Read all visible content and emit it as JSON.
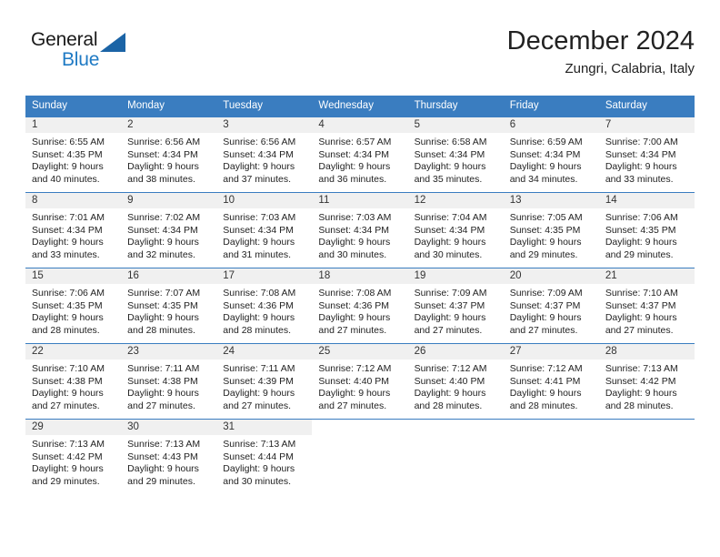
{
  "brand": {
    "name_top": "General",
    "name_bottom": "Blue",
    "accent_color": "#1f7ac4",
    "triangle_color": "#1b64a6"
  },
  "header": {
    "title": "December 2024",
    "subtitle": "Zungri, Calabria, Italy"
  },
  "theme": {
    "header_band": "#3a7dc0",
    "daynum_strip": "#f0f0f0",
    "text": "#222222"
  },
  "weekday_headers": [
    "Sunday",
    "Monday",
    "Tuesday",
    "Wednesday",
    "Thursday",
    "Friday",
    "Saturday"
  ],
  "weeks": [
    [
      {
        "day": "1",
        "sunrise": "Sunrise: 6:55 AM",
        "sunset": "Sunset: 4:35 PM",
        "daylight_line1": "Daylight: 9 hours",
        "daylight_line2": "and 40 minutes."
      },
      {
        "day": "2",
        "sunrise": "Sunrise: 6:56 AM",
        "sunset": "Sunset: 4:34 PM",
        "daylight_line1": "Daylight: 9 hours",
        "daylight_line2": "and 38 minutes."
      },
      {
        "day": "3",
        "sunrise": "Sunrise: 6:56 AM",
        "sunset": "Sunset: 4:34 PM",
        "daylight_line1": "Daylight: 9 hours",
        "daylight_line2": "and 37 minutes."
      },
      {
        "day": "4",
        "sunrise": "Sunrise: 6:57 AM",
        "sunset": "Sunset: 4:34 PM",
        "daylight_line1": "Daylight: 9 hours",
        "daylight_line2": "and 36 minutes."
      },
      {
        "day": "5",
        "sunrise": "Sunrise: 6:58 AM",
        "sunset": "Sunset: 4:34 PM",
        "daylight_line1": "Daylight: 9 hours",
        "daylight_line2": "and 35 minutes."
      },
      {
        "day": "6",
        "sunrise": "Sunrise: 6:59 AM",
        "sunset": "Sunset: 4:34 PM",
        "daylight_line1": "Daylight: 9 hours",
        "daylight_line2": "and 34 minutes."
      },
      {
        "day": "7",
        "sunrise": "Sunrise: 7:00 AM",
        "sunset": "Sunset: 4:34 PM",
        "daylight_line1": "Daylight: 9 hours",
        "daylight_line2": "and 33 minutes."
      }
    ],
    [
      {
        "day": "8",
        "sunrise": "Sunrise: 7:01 AM",
        "sunset": "Sunset: 4:34 PM",
        "daylight_line1": "Daylight: 9 hours",
        "daylight_line2": "and 33 minutes."
      },
      {
        "day": "9",
        "sunrise": "Sunrise: 7:02 AM",
        "sunset": "Sunset: 4:34 PM",
        "daylight_line1": "Daylight: 9 hours",
        "daylight_line2": "and 32 minutes."
      },
      {
        "day": "10",
        "sunrise": "Sunrise: 7:03 AM",
        "sunset": "Sunset: 4:34 PM",
        "daylight_line1": "Daylight: 9 hours",
        "daylight_line2": "and 31 minutes."
      },
      {
        "day": "11",
        "sunrise": "Sunrise: 7:03 AM",
        "sunset": "Sunset: 4:34 PM",
        "daylight_line1": "Daylight: 9 hours",
        "daylight_line2": "and 30 minutes."
      },
      {
        "day": "12",
        "sunrise": "Sunrise: 7:04 AM",
        "sunset": "Sunset: 4:34 PM",
        "daylight_line1": "Daylight: 9 hours",
        "daylight_line2": "and 30 minutes."
      },
      {
        "day": "13",
        "sunrise": "Sunrise: 7:05 AM",
        "sunset": "Sunset: 4:35 PM",
        "daylight_line1": "Daylight: 9 hours",
        "daylight_line2": "and 29 minutes."
      },
      {
        "day": "14",
        "sunrise": "Sunrise: 7:06 AM",
        "sunset": "Sunset: 4:35 PM",
        "daylight_line1": "Daylight: 9 hours",
        "daylight_line2": "and 29 minutes."
      }
    ],
    [
      {
        "day": "15",
        "sunrise": "Sunrise: 7:06 AM",
        "sunset": "Sunset: 4:35 PM",
        "daylight_line1": "Daylight: 9 hours",
        "daylight_line2": "and 28 minutes."
      },
      {
        "day": "16",
        "sunrise": "Sunrise: 7:07 AM",
        "sunset": "Sunset: 4:35 PM",
        "daylight_line1": "Daylight: 9 hours",
        "daylight_line2": "and 28 minutes."
      },
      {
        "day": "17",
        "sunrise": "Sunrise: 7:08 AM",
        "sunset": "Sunset: 4:36 PM",
        "daylight_line1": "Daylight: 9 hours",
        "daylight_line2": "and 28 minutes."
      },
      {
        "day": "18",
        "sunrise": "Sunrise: 7:08 AM",
        "sunset": "Sunset: 4:36 PM",
        "daylight_line1": "Daylight: 9 hours",
        "daylight_line2": "and 27 minutes."
      },
      {
        "day": "19",
        "sunrise": "Sunrise: 7:09 AM",
        "sunset": "Sunset: 4:37 PM",
        "daylight_line1": "Daylight: 9 hours",
        "daylight_line2": "and 27 minutes."
      },
      {
        "day": "20",
        "sunrise": "Sunrise: 7:09 AM",
        "sunset": "Sunset: 4:37 PM",
        "daylight_line1": "Daylight: 9 hours",
        "daylight_line2": "and 27 minutes."
      },
      {
        "day": "21",
        "sunrise": "Sunrise: 7:10 AM",
        "sunset": "Sunset: 4:37 PM",
        "daylight_line1": "Daylight: 9 hours",
        "daylight_line2": "and 27 minutes."
      }
    ],
    [
      {
        "day": "22",
        "sunrise": "Sunrise: 7:10 AM",
        "sunset": "Sunset: 4:38 PM",
        "daylight_line1": "Daylight: 9 hours",
        "daylight_line2": "and 27 minutes."
      },
      {
        "day": "23",
        "sunrise": "Sunrise: 7:11 AM",
        "sunset": "Sunset: 4:38 PM",
        "daylight_line1": "Daylight: 9 hours",
        "daylight_line2": "and 27 minutes."
      },
      {
        "day": "24",
        "sunrise": "Sunrise: 7:11 AM",
        "sunset": "Sunset: 4:39 PM",
        "daylight_line1": "Daylight: 9 hours",
        "daylight_line2": "and 27 minutes."
      },
      {
        "day": "25",
        "sunrise": "Sunrise: 7:12 AM",
        "sunset": "Sunset: 4:40 PM",
        "daylight_line1": "Daylight: 9 hours",
        "daylight_line2": "and 27 minutes."
      },
      {
        "day": "26",
        "sunrise": "Sunrise: 7:12 AM",
        "sunset": "Sunset: 4:40 PM",
        "daylight_line1": "Daylight: 9 hours",
        "daylight_line2": "and 28 minutes."
      },
      {
        "day": "27",
        "sunrise": "Sunrise: 7:12 AM",
        "sunset": "Sunset: 4:41 PM",
        "daylight_line1": "Daylight: 9 hours",
        "daylight_line2": "and 28 minutes."
      },
      {
        "day": "28",
        "sunrise": "Sunrise: 7:13 AM",
        "sunset": "Sunset: 4:42 PM",
        "daylight_line1": "Daylight: 9 hours",
        "daylight_line2": "and 28 minutes."
      }
    ],
    [
      {
        "day": "29",
        "sunrise": "Sunrise: 7:13 AM",
        "sunset": "Sunset: 4:42 PM",
        "daylight_line1": "Daylight: 9 hours",
        "daylight_line2": "and 29 minutes."
      },
      {
        "day": "30",
        "sunrise": "Sunrise: 7:13 AM",
        "sunset": "Sunset: 4:43 PM",
        "daylight_line1": "Daylight: 9 hours",
        "daylight_line2": "and 29 minutes."
      },
      {
        "day": "31",
        "sunrise": "Sunrise: 7:13 AM",
        "sunset": "Sunset: 4:44 PM",
        "daylight_line1": "Daylight: 9 hours",
        "daylight_line2": "and 30 minutes."
      },
      {
        "day": "",
        "sunrise": "",
        "sunset": "",
        "daylight_line1": "",
        "daylight_line2": ""
      },
      {
        "day": "",
        "sunrise": "",
        "sunset": "",
        "daylight_line1": "",
        "daylight_line2": ""
      },
      {
        "day": "",
        "sunrise": "",
        "sunset": "",
        "daylight_line1": "",
        "daylight_line2": ""
      },
      {
        "day": "",
        "sunrise": "",
        "sunset": "",
        "daylight_line1": "",
        "daylight_line2": ""
      }
    ]
  ]
}
